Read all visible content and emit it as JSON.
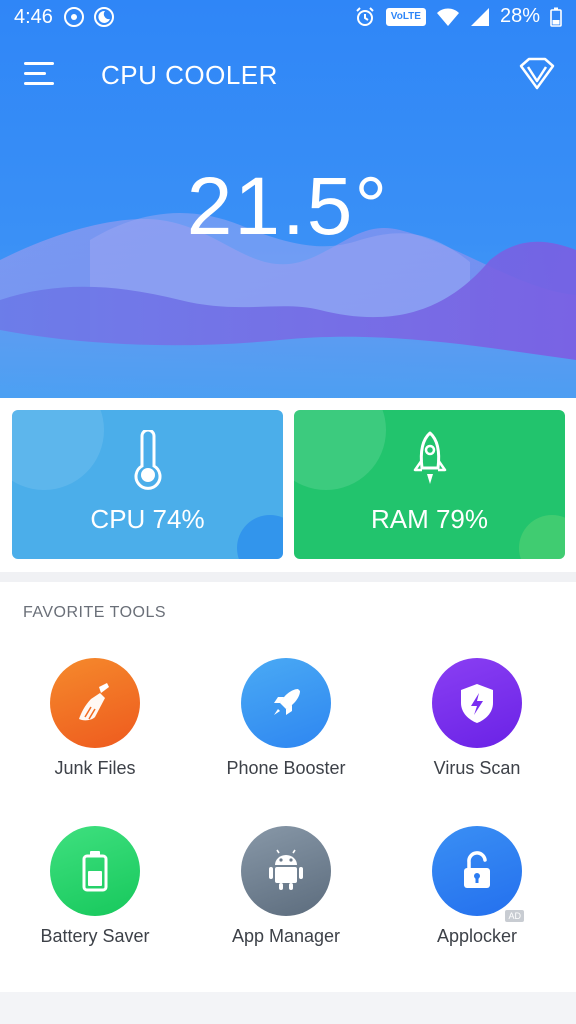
{
  "status_bar": {
    "time": "4:46",
    "volte": "VoLTE",
    "battery": "28%"
  },
  "header": {
    "title": "CPU COOLER",
    "temperature": "21.5°"
  },
  "cards": {
    "cpu_label": "CPU 74%",
    "ram_label": "RAM 79%"
  },
  "tools": {
    "section_title": "FAVORITE TOOLS",
    "items": [
      {
        "label": "Junk Files",
        "icon": "broom-icon",
        "color": "#f26a21"
      },
      {
        "label": "Phone Booster",
        "icon": "rocket-icon",
        "color": "#2e8ff3"
      },
      {
        "label": "Virus Scan",
        "icon": "shield-icon",
        "color": "#7a2ff0"
      },
      {
        "label": "Battery Saver",
        "icon": "battery-icon",
        "color": "#1fd66a"
      },
      {
        "label": "App Manager",
        "icon": "android-icon",
        "color": "#6c7c8c"
      },
      {
        "label": "Applocker",
        "icon": "lock-icon",
        "color": "#2b7cf2"
      }
    ],
    "ad_badge": "AD"
  },
  "colors": {
    "header_blue": "#2f86f7",
    "cpu_card": "#4baeea",
    "ram_card": "#22c46d"
  }
}
